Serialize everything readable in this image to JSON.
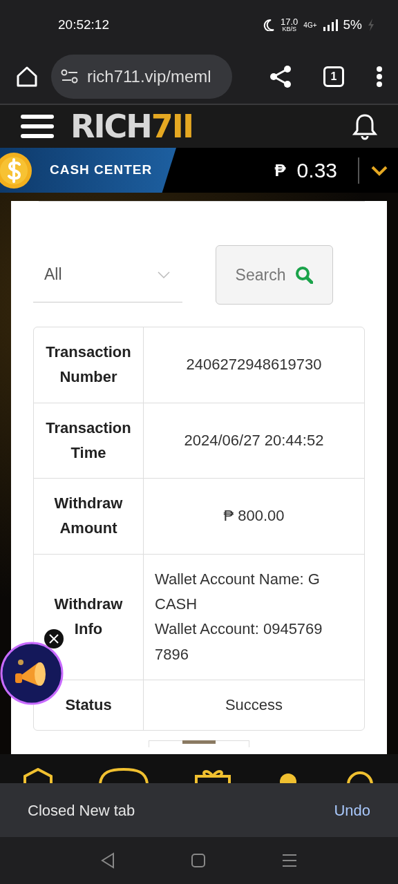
{
  "status_bar": {
    "time": "20:52:12",
    "speed": "17.0",
    "speed_unit": "KB/S",
    "network": "4G+",
    "battery": "5%"
  },
  "browser": {
    "url": "rich711.vip/meml",
    "tab_count": "1"
  },
  "site_header": {
    "logo_main": "RICH",
    "logo_accent": "7II"
  },
  "cash_center": {
    "label": "CASH CENTER",
    "currency": "₱",
    "balance": "0.33"
  },
  "filter": {
    "value": "All",
    "search_label": "Search"
  },
  "details": [
    {
      "label": "Transaction Number",
      "lines": [
        "2406272948619730"
      ]
    },
    {
      "label": "Transaction Time",
      "lines": [
        "2024/06/27 20:44:52"
      ]
    },
    {
      "label": "Withdraw Amount",
      "lines": [
        "₱ 800.00"
      ]
    },
    {
      "label": "Withdraw Info",
      "lines": [
        "Wallet Account Name: G CASH",
        "Wallet Account: 0945769 7896"
      ]
    },
    {
      "label": "Status",
      "lines": [
        "Success"
      ]
    }
  ],
  "snackbar": {
    "message": "Closed New tab",
    "action": "Undo"
  }
}
